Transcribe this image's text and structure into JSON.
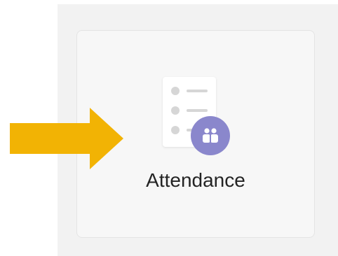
{
  "tile": {
    "label": "Attendance",
    "icon": "attendance-list-icon",
    "badge_icon": "people-icon"
  },
  "annotation": {
    "icon": "arrow-right-icon",
    "color": "#F2B304"
  },
  "colors": {
    "panel_bg": "#f2f2f2",
    "tile_bg": "#f7f7f7",
    "badge": "#8a87cc",
    "text": "#242424"
  }
}
